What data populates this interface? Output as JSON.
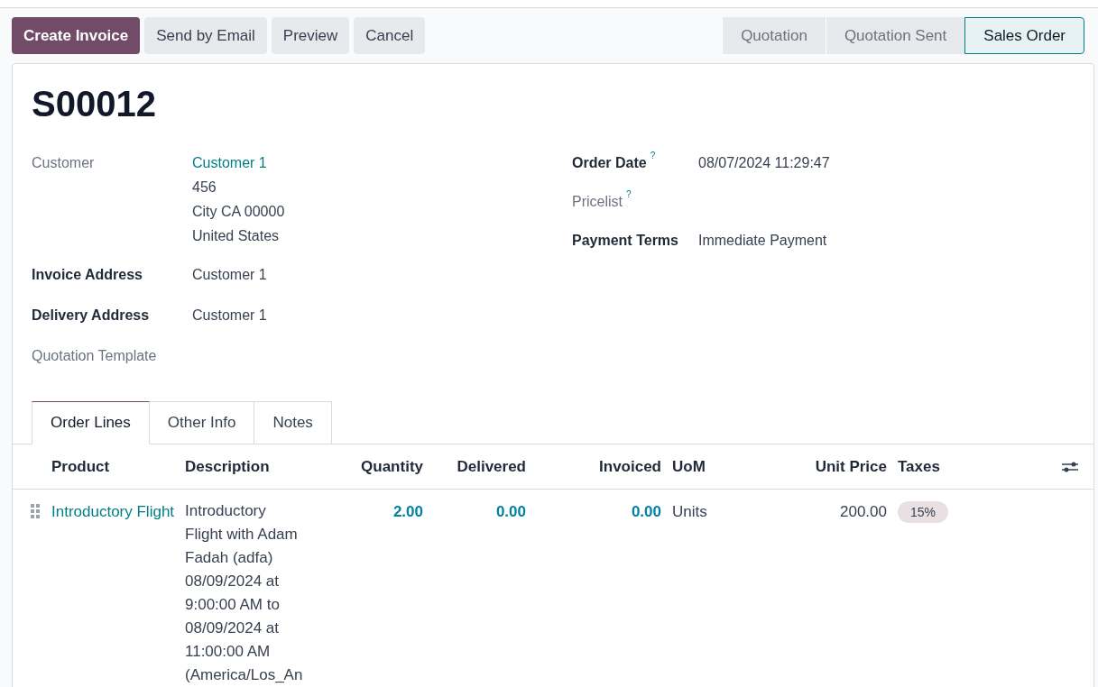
{
  "actions": [
    {
      "label": "Create Invoice",
      "primary": true
    },
    {
      "label": "Send by Email",
      "primary": false
    },
    {
      "label": "Preview",
      "primary": false
    },
    {
      "label": "Cancel",
      "primary": false
    }
  ],
  "stages": [
    {
      "label": "Quotation",
      "selected": false
    },
    {
      "label": "Quotation Sent",
      "selected": false
    },
    {
      "label": "Sales Order",
      "selected": true
    }
  ],
  "title": "S00012",
  "left_fields": [
    {
      "label": "Customer",
      "required": false,
      "values": [
        {
          "kind": "link",
          "text": "Customer 1"
        },
        {
          "kind": "text",
          "text": "456"
        },
        {
          "kind": "text",
          "text": "City CA 00000"
        },
        {
          "kind": "text",
          "text": "United States"
        }
      ]
    },
    {
      "label": "Invoice Address",
      "required": true,
      "values": [
        {
          "kind": "text",
          "text": "Customer 1"
        }
      ]
    },
    {
      "label": "Delivery Address",
      "required": true,
      "values": [
        {
          "kind": "text",
          "text": "Customer 1"
        }
      ]
    },
    {
      "label": "Quotation Template",
      "required": false
    }
  ],
  "right_fields": [
    {
      "label": "Order Date",
      "required": true,
      "help": "?",
      "values": [
        {
          "kind": "text",
          "text": "08/07/2024 11:29:47"
        }
      ]
    },
    {
      "label": "Pricelist",
      "required": false,
      "help": "?"
    },
    {
      "label": "Payment Terms",
      "required": true,
      "values": [
        {
          "kind": "text",
          "text": "Immediate Payment"
        }
      ]
    }
  ],
  "tabs": [
    {
      "label": "Order Lines",
      "selected": true
    },
    {
      "label": "Other Info",
      "selected": false
    },
    {
      "label": "Notes",
      "selected": false
    }
  ],
  "table": {
    "columns": [
      "Product",
      "Description",
      "Quantity",
      "Delivered",
      "Invoiced",
      "UoM",
      "Unit Price",
      "Taxes"
    ],
    "rows": [
      {
        "product": "Introductory Flight",
        "description": "Introductory Flight with Adam Fadah (adfa) 08/09/2024 at 9:00:00 AM to 08/09/2024 at 11:00:00 AM (America/Los_An",
        "quantity": "2.00",
        "delivered": "0.00",
        "invoiced": "0.00",
        "uom": "Units",
        "unit_price": "200.00",
        "taxes": "15%"
      }
    ]
  }
}
